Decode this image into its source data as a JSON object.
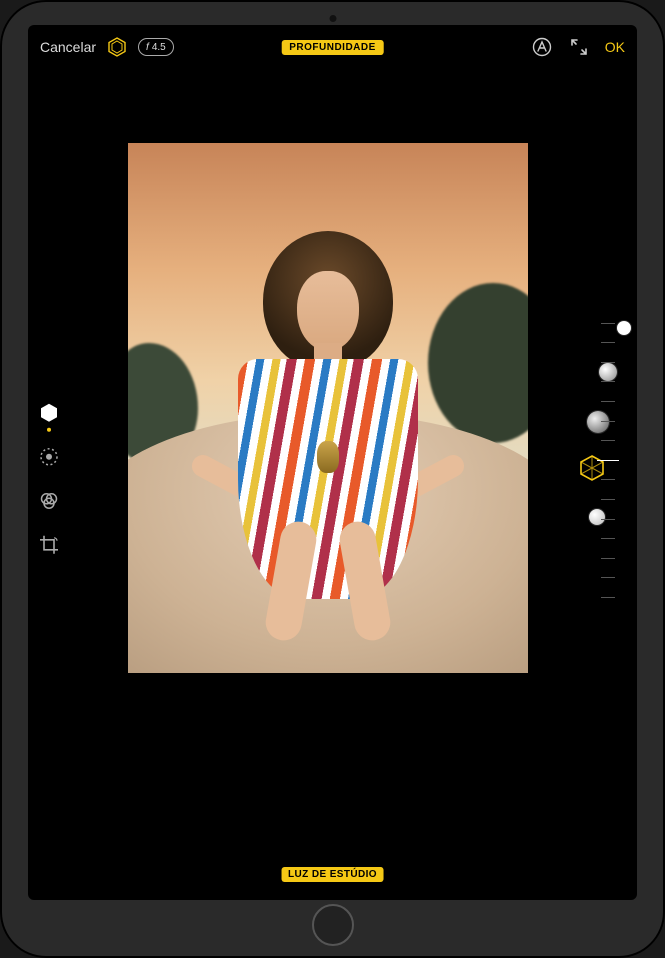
{
  "toolbar": {
    "cancel_label": "Cancelar",
    "f_value": "4.5",
    "mode_badge": "PROFUNDIDADE",
    "done_label": "OK"
  },
  "left_tools": {
    "active_index": 0
  },
  "lighting": {
    "selected_label": "LUZ DE ESTÚDIO"
  },
  "colors": {
    "accent": "#f5c815"
  }
}
